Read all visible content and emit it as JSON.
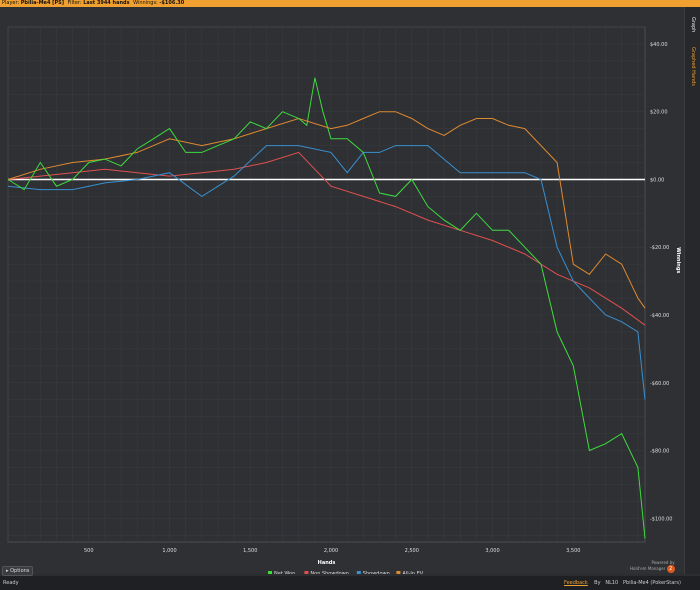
{
  "topbar": {
    "player_label": "Player:",
    "player_name": "Pbilia-Me4 [PS]",
    "filter_label": "Filter:",
    "filter_value": "Last 3944 hands",
    "winnings_label": "Winnings:",
    "winnings_value": "-$106.30"
  },
  "right_tabs": {
    "graph": "Graph",
    "graphed_hands": "Graphed Hands"
  },
  "options_button": "Options",
  "status": {
    "ready": "Ready",
    "feedback": "Feedback",
    "by": "By",
    "limit": "NL10",
    "player": "Pbilia-Me4 (PokerStars)"
  },
  "powered_by": {
    "line1": "Powered by",
    "line2": "Hold'em Manager",
    "badge": "2"
  },
  "colors": {
    "net_won": "#3ddc3d",
    "non_showdown": "#e05050",
    "showdown": "#3a90d0",
    "allin_ev": "#e08a30",
    "zero_line": "#ffffff"
  },
  "chart_data": {
    "type": "line",
    "xlabel": "Hands",
    "ylabel": "Winnings",
    "xlim": [
      0,
      3944
    ],
    "ylim": [
      -107,
      45
    ],
    "xticks": [
      500,
      1000,
      1500,
      2000,
      2500,
      3000,
      3500
    ],
    "xtick_labels": [
      "500",
      "1,000",
      "1,500",
      "2,000",
      "2,500",
      "3,000",
      "3,500"
    ],
    "yticks": [
      40,
      20,
      0,
      -20,
      -40,
      -60,
      -80,
      -100
    ],
    "ytick_labels": [
      "$40.00",
      "$20.00",
      "$0.00",
      "-$20.00",
      "-$40.00",
      "-$60.00",
      "-$80.00",
      "-$100.00"
    ],
    "grid": true,
    "legend_position": "bottom",
    "series": [
      {
        "name": "Net Won",
        "x": [
          0,
          100,
          200,
          300,
          400,
          500,
          600,
          700,
          800,
          900,
          1000,
          1100,
          1200,
          1300,
          1400,
          1500,
          1600,
          1700,
          1800,
          1850,
          1900,
          1950,
          2000,
          2100,
          2200,
          2300,
          2400,
          2500,
          2600,
          2700,
          2800,
          2900,
          3000,
          3100,
          3200,
          3300,
          3400,
          3500,
          3600,
          3700,
          3800,
          3900,
          3944
        ],
        "values": [
          0,
          -3,
          5,
          -2,
          0,
          5,
          6,
          4,
          9,
          12,
          15,
          8,
          8,
          10,
          12,
          17,
          15,
          20,
          18,
          16,
          30,
          20,
          12,
          12,
          8,
          -4,
          -5,
          0,
          -8,
          -12,
          -15,
          -10,
          -15,
          -15,
          -20,
          -25,
          -45,
          -55,
          -80,
          -78,
          -75,
          -85,
          -106
        ]
      },
      {
        "name": "Non Showdown",
        "x": [
          0,
          200,
          400,
          600,
          800,
          1000,
          1200,
          1400,
          1600,
          1800,
          2000,
          2200,
          2400,
          2600,
          2800,
          3000,
          3200,
          3400,
          3600,
          3800,
          3944
        ],
        "values": [
          0,
          1,
          2,
          3,
          2,
          1,
          2,
          3,
          5,
          8,
          -2,
          -5,
          -8,
          -12,
          -15,
          -18,
          -22,
          -28,
          -32,
          -38,
          -43
        ]
      },
      {
        "name": "Showdown",
        "x": [
          0,
          200,
          400,
          600,
          800,
          1000,
          1200,
          1400,
          1600,
          1800,
          2000,
          2100,
          2200,
          2300,
          2400,
          2600,
          2800,
          3000,
          3200,
          3300,
          3400,
          3500,
          3600,
          3700,
          3800,
          3900,
          3944
        ],
        "values": [
          -2,
          -3,
          -3,
          -1,
          0,
          2,
          -5,
          1,
          10,
          10,
          8,
          2,
          8,
          8,
          10,
          10,
          2,
          2,
          2,
          0,
          -20,
          -30,
          -35,
          -40,
          -42,
          -45,
          -65
        ]
      },
      {
        "name": "All-In EV",
        "x": [
          0,
          200,
          400,
          600,
          800,
          1000,
          1200,
          1400,
          1600,
          1800,
          2000,
          2100,
          2200,
          2300,
          2400,
          2500,
          2600,
          2700,
          2800,
          2900,
          3000,
          3100,
          3200,
          3300,
          3400,
          3500,
          3600,
          3700,
          3800,
          3900,
          3944
        ],
        "values": [
          0,
          3,
          5,
          6,
          8,
          12,
          10,
          12,
          15,
          18,
          15,
          16,
          18,
          20,
          20,
          18,
          15,
          13,
          16,
          18,
          18,
          16,
          15,
          10,
          5,
          -25,
          -28,
          -22,
          -25,
          -35,
          -38
        ]
      }
    ]
  }
}
